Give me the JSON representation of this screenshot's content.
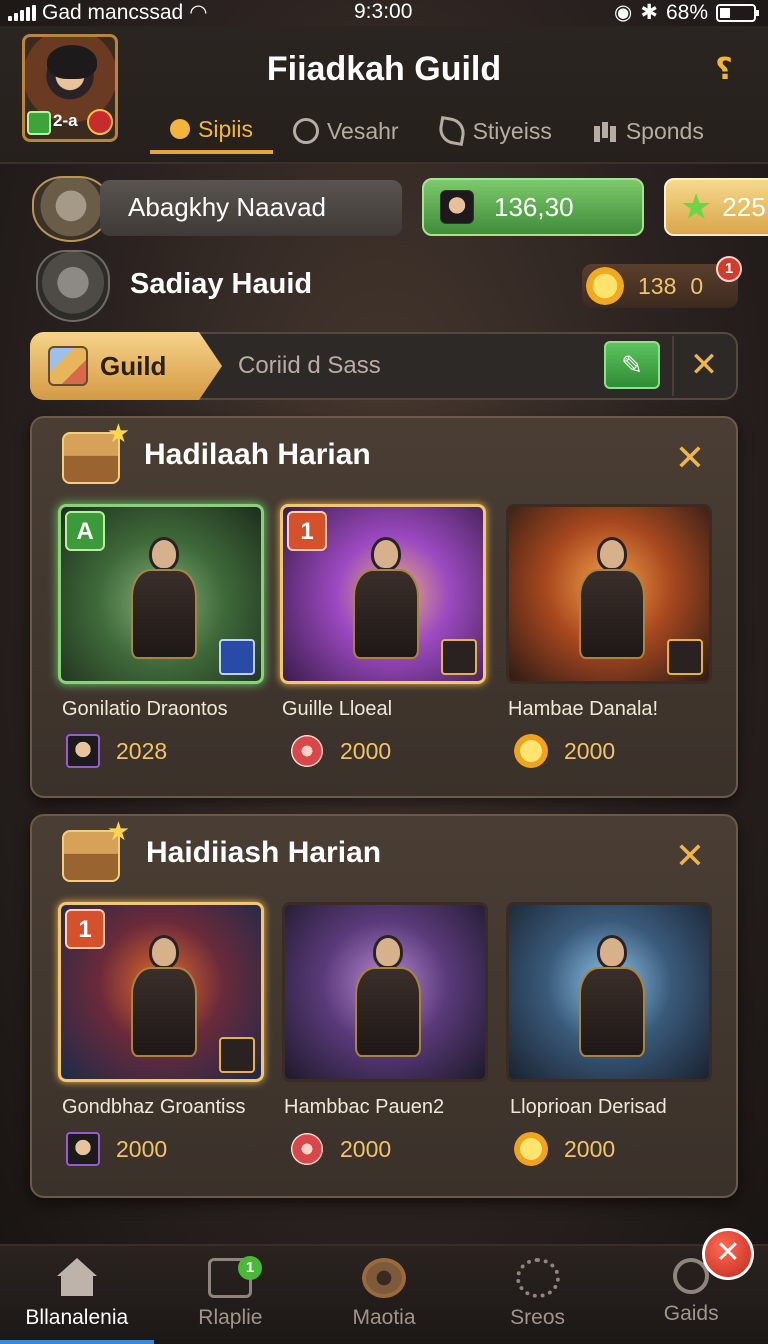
{
  "status_bar": {
    "carrier": "Gad mancssad",
    "time": "9:3:00",
    "battery": "68%"
  },
  "header": {
    "title": "Fiiadkah Guild",
    "level": "2-a",
    "tabs": [
      {
        "label": "Sipiis",
        "icon": "spoon-icon",
        "active": true
      },
      {
        "label": "Vesahr",
        "icon": "clock-icon",
        "active": false
      },
      {
        "label": "Stiyeiss",
        "icon": "leaf-icon",
        "active": false
      },
      {
        "label": "Sponds",
        "icon": "bars-icon",
        "active": false
      }
    ]
  },
  "player": {
    "name": "Abagkhy Naavad",
    "gems": "136,30",
    "stars": "225",
    "secondary_name": "Sadiay Hauid",
    "coins": "138",
    "coins_extra": "0",
    "notification_count": "1"
  },
  "guild_bar": {
    "tag_label": "Guild",
    "placeholder": "Coriid d Sass"
  },
  "panels": [
    {
      "title": "Hadilaah Harian",
      "cards": [
        {
          "name": "Gonilatio Draontos",
          "reward": "2028",
          "reward_icon": "hero-face-icon",
          "badge": "A"
        },
        {
          "name": "Guille Lloeal",
          "reward": "2000",
          "reward_icon": "gear-token-icon",
          "badge": "1"
        },
        {
          "name": "Hambae Danala!",
          "reward": "2000",
          "reward_icon": "sun-coin-icon",
          "badge": ""
        }
      ]
    },
    {
      "title": "Haidiiash Harian",
      "cards": [
        {
          "name": "Gondbhaz Groantiss",
          "reward": "2000",
          "reward_icon": "hero-face-icon",
          "badge": "1"
        },
        {
          "name": "Hambbac Pauen2",
          "reward": "2000",
          "reward_icon": "gear-token-icon",
          "badge": ""
        },
        {
          "name": "Lloprioan Derisad",
          "reward": "2000",
          "reward_icon": "sun-coin-icon",
          "badge": ""
        }
      ]
    }
  ],
  "bottom_nav": [
    {
      "label": "Bllanalenia",
      "icon": "home-icon",
      "active": true
    },
    {
      "label": "Rlaplie",
      "icon": "share-icon",
      "active": false,
      "badge": "1"
    },
    {
      "label": "Maotia",
      "icon": "gear-icon",
      "active": false
    },
    {
      "label": "Sreos",
      "icon": "cog-icon",
      "active": false
    },
    {
      "label": "Gaids",
      "icon": "search-icon",
      "active": false
    }
  ],
  "colors": {
    "accent": "#e6a43a",
    "gem_green": "#3f8c3a",
    "close_red": "#c2281c"
  }
}
